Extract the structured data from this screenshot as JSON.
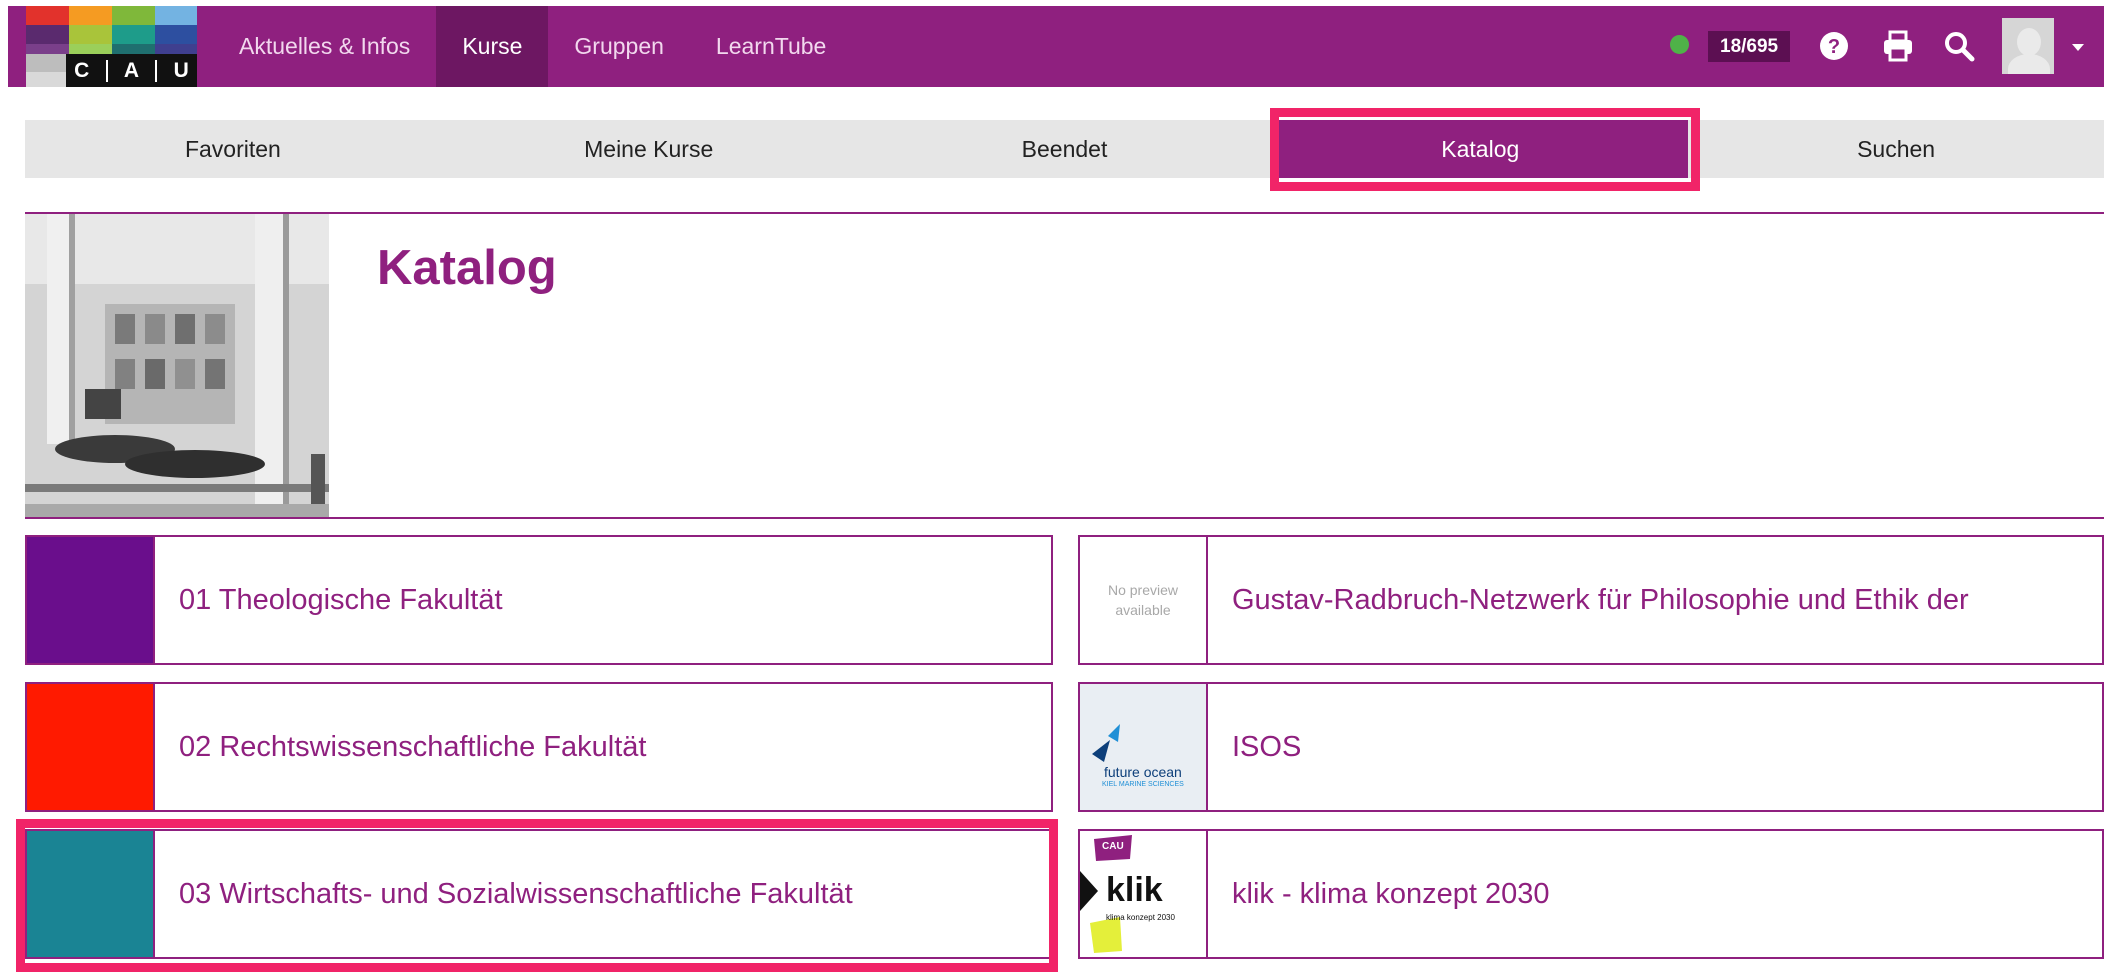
{
  "logo": {
    "letters": [
      "C",
      "A",
      "U"
    ],
    "colors": [
      "#e2322c",
      "#f59b22",
      "#7fb83a",
      "#1e9c8a",
      "#73b3e2",
      "#3f3f8f",
      "#1f6f6f",
      "#2d4fa0"
    ]
  },
  "nav": {
    "items": [
      {
        "label": "Aktuelles & Infos",
        "active": false
      },
      {
        "label": "Kurse",
        "active": true
      },
      {
        "label": "Gruppen",
        "active": false
      },
      {
        "label": "LearnTube",
        "active": false
      }
    ]
  },
  "status": {
    "counter": "18/695",
    "dot_color": "#4fb248"
  },
  "icons": [
    "help-icon",
    "print-icon",
    "search-icon",
    "avatar",
    "chevron-down-icon"
  ],
  "subtabs": [
    {
      "label": "Favoriten",
      "active": false
    },
    {
      "label": "Meine Kurse",
      "active": false
    },
    {
      "label": "Beendet",
      "active": false
    },
    {
      "label": "Katalog",
      "active": true
    },
    {
      "label": "Suchen",
      "active": false
    }
  ],
  "page": {
    "title": "Katalog"
  },
  "cards_left": [
    {
      "label": "01 Theologische Fakultät",
      "color": "#6a0e8c"
    },
    {
      "label": "02 Rechtswissenschaftliche Fakultät",
      "color": "#ff1a00"
    },
    {
      "label": "03 Wirtschafts- und Sozialwissenschaftliche Fakultät",
      "color": "#1a8494"
    }
  ],
  "cards_right": [
    {
      "label": "Gustav-Radbruch-Netzwerk für Philosophie und Ethik der",
      "thumb": "No preview available"
    },
    {
      "label": "ISOS",
      "thumb": "future ocean",
      "thumb_sub": "KIEL MARINE SCIENCES"
    },
    {
      "label": "klik - klima konzept 2030",
      "thumb": "klik",
      "thumb_sub": "klima konzept 2030",
      "thumb_badge": "CAU"
    }
  ],
  "colors": {
    "brand": "#8f207f",
    "highlight": "#f12468"
  }
}
